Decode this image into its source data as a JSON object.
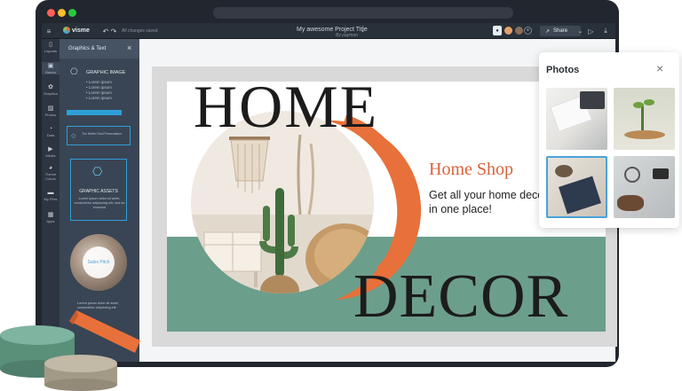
{
  "topbar": {
    "logo": "visme",
    "saved_status": "All changes saved",
    "project_title": "My awesome Project Title",
    "byline": "By paymon",
    "share_label": "Share"
  },
  "rail": [
    {
      "label": "Layouts",
      "icon": "layouts-icon",
      "glyph": "▯"
    },
    {
      "label": "Basics",
      "icon": "basics-icon",
      "glyph": "▣"
    },
    {
      "label": "Graphics",
      "icon": "graphics-icon",
      "glyph": "✿"
    },
    {
      "label": "Photos",
      "icon": "photos-icon",
      "glyph": "▨"
    },
    {
      "label": "Data",
      "icon": "data-icon",
      "glyph": "◔"
    },
    {
      "label": "Media",
      "icon": "media-icon",
      "glyph": "▶"
    },
    {
      "label": "Theme Colors",
      "icon": "palette-icon",
      "glyph": "◕"
    },
    {
      "label": "My Files",
      "icon": "folder-icon",
      "glyph": "▬"
    },
    {
      "label": "Apps",
      "icon": "apps-icon",
      "glyph": "▦"
    }
  ],
  "panel": {
    "title": "Graphics & Text",
    "graphic_image_title": "GRAPHIC IMAGE",
    "bullets": [
      "Lorem ipsum",
      "Lorem ipsum",
      "Lorem ipsum",
      "Lorem ipsum"
    ],
    "card2_text": "The Better Deal Presentation",
    "graphic_assets_title": "GRAPHIC ASSETS",
    "graphic_assets_desc": "Lorem ipsum dolor sit amet, consectetur adipiscing elit, sed do eiusmod",
    "sales_pitch": "Sales Pitch",
    "bottom_desc": "Lorem ipsum dolor sit amet, consectetur adipiscing elit."
  },
  "slide": {
    "heading_top": "HOME",
    "heading_bottom": "DECOR",
    "brand": "Home Shop",
    "tagline_line1": "Get all your home decor",
    "tagline_line2": "in one place!"
  },
  "photos_panel": {
    "title": "Photos",
    "images": [
      "desk-notebook-photo",
      "plant-coins-photo",
      "clothes-suitcase-photo",
      "tools-flatlay-photo"
    ]
  },
  "colors": {
    "accent_orange": "#e8703a",
    "slide_green": "#6c9e8c",
    "sidebar_dark": "#394554",
    "brand_text": "#d9643a"
  }
}
